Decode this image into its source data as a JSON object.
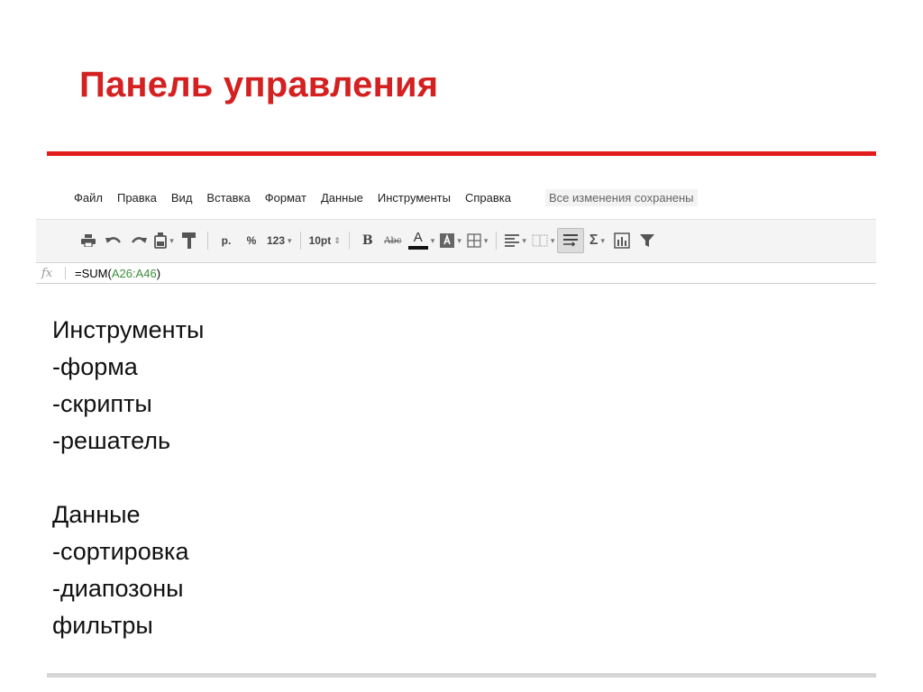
{
  "slide": {
    "title": "Панель управления",
    "accent_color": "#e21b1b"
  },
  "menubar": {
    "items": [
      "Файл",
      "Правка",
      "Вид",
      "Вставка",
      "Формат",
      "Данные",
      "Инструменты",
      "Справка"
    ],
    "status": "Все изменения сохранены"
  },
  "toolbar": {
    "currency": "р.",
    "percent": "%",
    "number_format": "123",
    "font_size": "10pt",
    "bold": "B",
    "strike": "Abc",
    "text_color": "A",
    "sum": "Σ",
    "icons": [
      "print-icon",
      "undo-icon",
      "redo-icon",
      "paint-bucket-icon",
      "paint-format-icon",
      "text-color-icon",
      "fill-color-icon",
      "borders-icon",
      "align-icon",
      "merge-cells-icon",
      "wrap-text-icon",
      "sum-icon",
      "chart-icon",
      "filter-icon"
    ]
  },
  "formula_bar": {
    "fx": "fx",
    "prefix": "=SUM(",
    "range": "A26:A46",
    "suffix": ")"
  },
  "content": {
    "group1": [
      "Инструменты",
      "-форма",
      "-скрипты",
      "-решатель"
    ],
    "group2": [
      "Данные",
      "-сортировка",
      "-диапозоны",
      "фильтры"
    ]
  }
}
